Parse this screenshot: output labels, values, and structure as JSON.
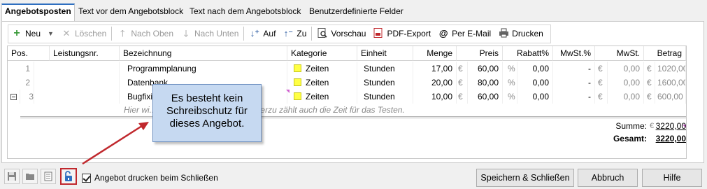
{
  "tabs": [
    {
      "label": "Angebotsposten",
      "active": true
    },
    {
      "label": "Text vor dem Angebotsblock",
      "active": false
    },
    {
      "label": "Text nach dem Angebotsblock",
      "active": false
    },
    {
      "label": "Benutzerdefinierte Felder",
      "active": false
    }
  ],
  "toolbar": {
    "new": "Neu",
    "delete": "Löschen",
    "up": "Nach Oben",
    "down": "Nach Unten",
    "expand": "Auf",
    "collapse": "Zu",
    "preview": "Vorschau",
    "pdf": "PDF-Export",
    "email": "Per E-Mail",
    "print": "Drucken"
  },
  "columns": [
    "Pos.",
    "Leistungsnr.",
    "Bezeichnung",
    "Kategorie",
    "Einheit",
    "Menge",
    "Preis",
    "Rabatt%",
    "MwSt.%",
    "MwSt.",
    "Betrag"
  ],
  "rows": [
    {
      "pos": "1",
      "nr": "",
      "bez": "Programmplanung",
      "kat": "Zeiten",
      "einheit": "Stunden",
      "menge": "17,00",
      "cur1": "€",
      "preis": "60,00",
      "pct": "%",
      "rabatt": "0,00",
      "mwstp": "-",
      "cur2": "€",
      "mwst": "0,00",
      "cur3": "€",
      "betrag": "1020,00"
    },
    {
      "pos": "2",
      "nr": "",
      "bez": "Datenbank...",
      "kat": "Zeiten",
      "einheit": "Stunden",
      "menge": "20,00",
      "cur1": "€",
      "preis": "80,00",
      "pct": "%",
      "rabatt": "0,00",
      "mwstp": "-",
      "cur2": "€",
      "mwst": "0,00",
      "cur3": "€",
      "betrag": "1600,00"
    },
    {
      "pos": "3",
      "nr": "",
      "bez": "Bugfixi...",
      "kat": "Zeiten",
      "einheit": "Stunden",
      "menge": "10,00",
      "cur1": "€",
      "preis": "60,00",
      "pct": "%",
      "rabatt": "0,00",
      "mwstp": "-",
      "cur2": "€",
      "mwst": "0,00",
      "cur3": "€",
      "betrag": "600,00"
    }
  ],
  "row3_description": "Hier wi...                          s Bugfixing festgehalten. Hierzu zählt auch die Zeit für das Testen.",
  "summary": {
    "sum_label": "Summe:",
    "sum_cur": "€",
    "sum_value": "3220,00",
    "total_label": "Gesamt:",
    "total_value": "3220,00"
  },
  "callout": {
    "text_line1": "Es besteht kein",
    "text_line2": "Schreibschutz für",
    "text_line3": "dieses Angebot."
  },
  "bottom": {
    "checkbox_label": "Angebot drucken beim Schließen",
    "checkbox_checked": true,
    "save_close": "Speichern & Schließen",
    "cancel": "Abbruch",
    "help": "Hilfe"
  },
  "colors": {
    "accent": "#2f6fc0",
    "category": "#ffff44",
    "callout_bg": "#c6d9f1",
    "arrow": "#c0282d"
  }
}
